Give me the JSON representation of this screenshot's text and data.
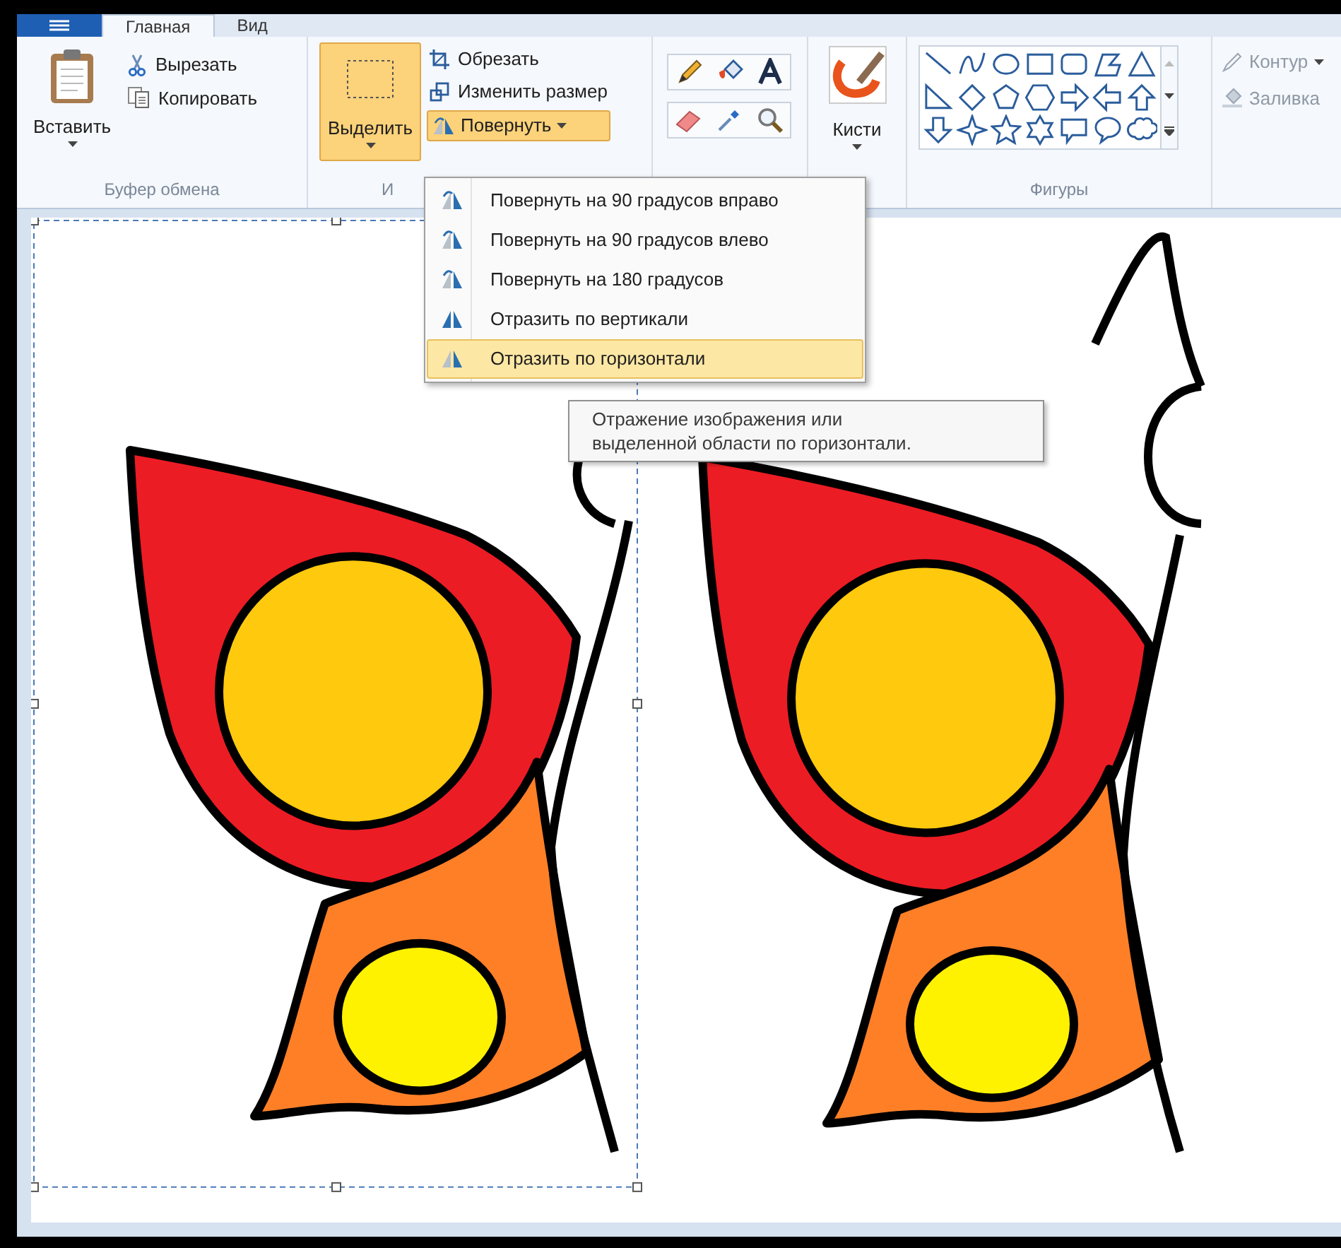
{
  "tabs": [
    {
      "label": "Главная",
      "selected": true
    },
    {
      "label": "Вид",
      "selected": false
    }
  ],
  "clipboard": {
    "paste": "Вставить",
    "cut": "Вырезать",
    "copy": "Копировать",
    "label": "Буфер обмена"
  },
  "image": {
    "select": {
      "label": "Выделить",
      "selected": true
    },
    "crop": "Обрезать",
    "resize": "Изменить размер",
    "rotate": {
      "label": "Повернуть",
      "expanded": true
    },
    "label": "И"
  },
  "brushes": "Кисти",
  "shapes": {
    "label": "Фигуры",
    "outline": {
      "label": "Контур",
      "disabled": true
    },
    "fill": {
      "label": "Заливка",
      "disabled": true
    }
  },
  "rotate_menu": [
    {
      "label": "Повернуть на 90 градусов вправо",
      "selected": false
    },
    {
      "label": "Повернуть на 90 градусов влево",
      "selected": false
    },
    {
      "label": "Повернуть на 180 градусов",
      "selected": false
    },
    {
      "label": "Отразить по вертикали",
      "selected": false
    },
    {
      "label": "Отразить по горизонтали",
      "selected": true
    }
  ],
  "tooltip": "Отражение изображения или выделенной области по горизонтали."
}
